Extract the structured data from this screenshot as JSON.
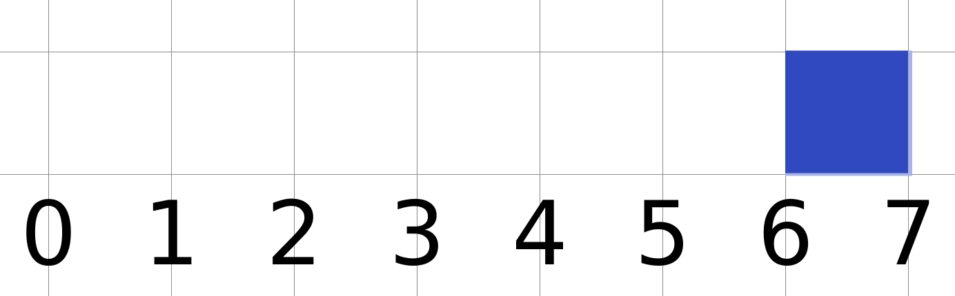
{
  "grid": {
    "columns": 8,
    "filled_cell": {
      "column": 6,
      "row": 1
    },
    "colors": {
      "line": "#8a8a8a",
      "fill": "#3049c0",
      "fill_edge": "#a8b4e6",
      "label": "#000000",
      "background": "#ffffff"
    }
  },
  "axis": {
    "labels": [
      "0",
      "1",
      "2",
      "3",
      "4",
      "5",
      "6",
      "7"
    ]
  }
}
